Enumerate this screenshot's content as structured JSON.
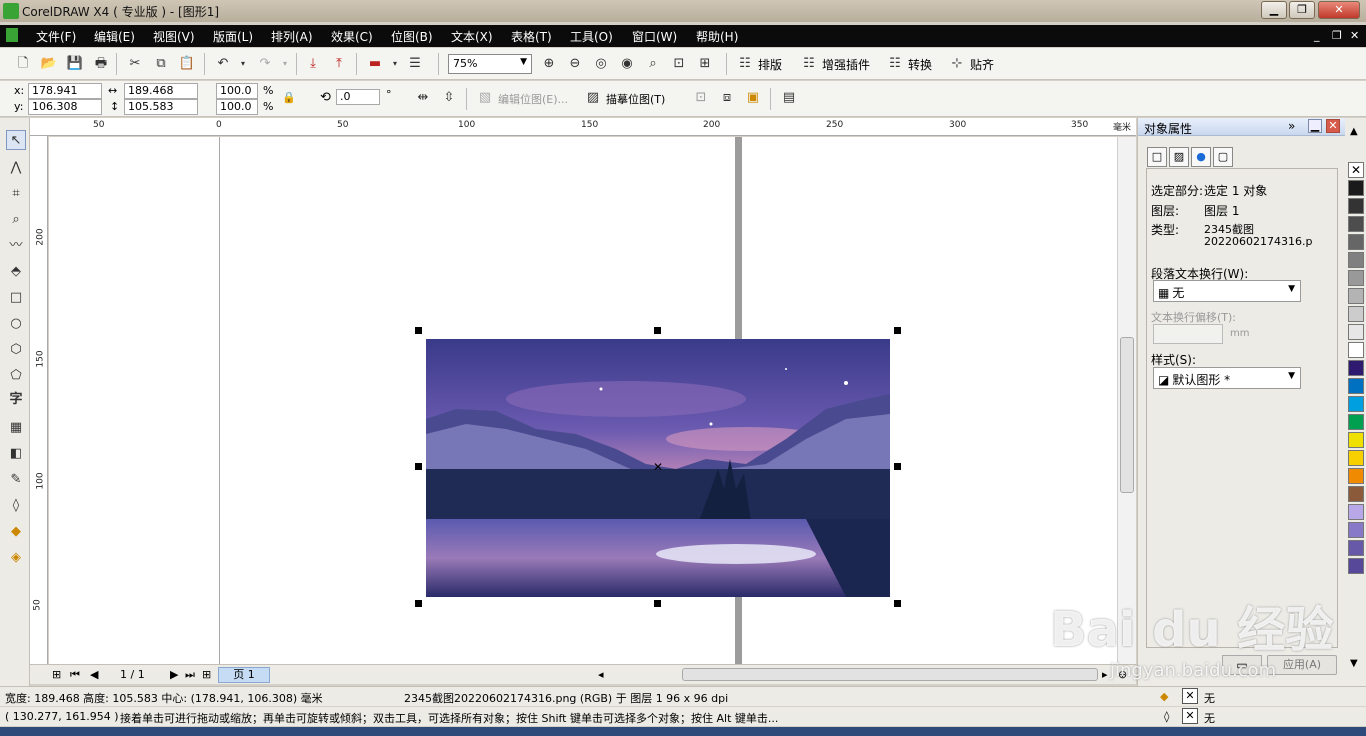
{
  "window": {
    "title": "CorelDRAW X4 ( 专业版 ) - [图形1]"
  },
  "menu": [
    "文件(F)",
    "编辑(E)",
    "视图(V)",
    "版面(L)",
    "排列(A)",
    "效果(C)",
    "位图(B)",
    "文本(X)",
    "表格(T)",
    "工具(O)",
    "窗口(W)",
    "帮助(H)"
  ],
  "toolbar": {
    "zoom": "75%",
    "buttons": [
      "排版",
      "增强插件",
      "转换",
      "贴齐"
    ]
  },
  "propbar": {
    "x": "178.941 mm",
    "y": "106.308 mm",
    "width": "189.468 mm",
    "height": "105.583 mm",
    "scale_x": "100.0",
    "scale_y": "100.0",
    "percent": "%",
    "rotation": ".0",
    "degree": "°",
    "edit_bitmap": "编辑位图(E)...",
    "trace_bitmap": "描摹位图(T)"
  },
  "ruler": {
    "h": [
      "50",
      "0",
      "50",
      "100",
      "150",
      "200",
      "250",
      "300",
      "350"
    ],
    "h_unit": "毫米",
    "v": [
      "200",
      "150",
      "100",
      "50"
    ]
  },
  "tools": [
    "pick-tool",
    "shape-tool",
    "crop-tool",
    "zoom-tool",
    "freehand-tool",
    "smart-fill-tool",
    "rectangle-tool",
    "ellipse-tool",
    "polygon-tool",
    "basic-shapes-tool",
    "text-tool",
    "table-tool",
    "interactive-tool",
    "eyedropper-tool",
    "outline-tool",
    "fill-tool",
    "interactive-fill-tool"
  ],
  "text_tool_glyph": "字",
  "pagenav": {
    "counter": "1 / 1",
    "tab": "页 1"
  },
  "docker": {
    "title": "对象属性",
    "selected_label": "选定部分:",
    "selected_value": "选定 1 对象",
    "layer_label": "图层:",
    "layer_value": "图层 1",
    "type_label": "类型:",
    "type_value_1": "2345截图",
    "type_value_2": "20220602174316.p",
    "wrap_label": "段落文本换行(W):",
    "wrap_value": "无",
    "offset_label": "文本换行偏移(T):",
    "offset_unit": "mm",
    "style_label": "样式(S):",
    "style_value": "默认图形 *",
    "apply": "应用(A)"
  },
  "status": {
    "line1_left": "宽度: 189.468  高度: 105.583  中心: (178.941, 106.308)  毫米",
    "line1_mid": "2345截图20220602174316.png (RGB) 于 图层 1 96 x 96 dpi",
    "line2_left": "( 130.277, 161.954 )",
    "line2_mid": "接着单击可进行拖动或缩放；再单击可旋转或倾斜；双击工具，可选择所有对象；按住 Shift 键单击可选择多个对象；按住 Alt 键单击...",
    "fill_none": "无",
    "outline_none": "无"
  },
  "palette_colors": [
    "#1a1a1a",
    "#333333",
    "#4d4d4d",
    "#666666",
    "#808080",
    "#999999",
    "#b3b3b3",
    "#cccccc",
    "#e6e6e6",
    "#ffffff",
    "#2e1a6e",
    "#0070c0",
    "#00a0e0",
    "#00a050",
    "#f0e000",
    "#f8d000",
    "#f08a00",
    "#8a5a3a",
    "#b8a8e8",
    "#8878c8",
    "#6858a8",
    "#58489a"
  ],
  "watermark": {
    "brand": "Bai du 经验",
    "url": "jingyan.baidu.com"
  }
}
